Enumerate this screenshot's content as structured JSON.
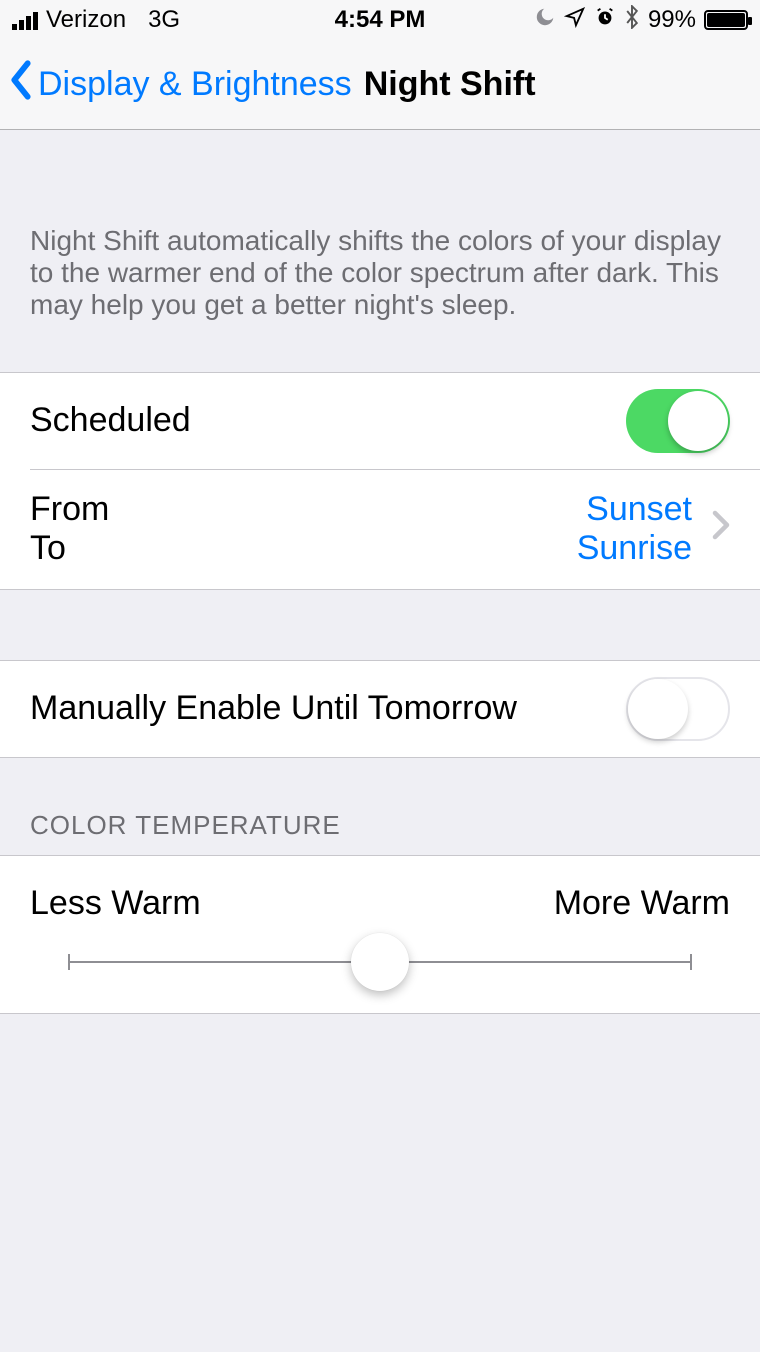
{
  "status": {
    "carrier": "Verizon",
    "network": "3G",
    "time": "4:54 PM",
    "battery_pct": "99%"
  },
  "nav": {
    "back_label": "Display & Brightness",
    "title": "Night Shift"
  },
  "intro": "Night Shift automatically shifts the colors of your display to the warmer end of the color spectrum after dark. This may help you get a better night's sleep.",
  "scheduled": {
    "label": "Scheduled",
    "on": true
  },
  "schedule_range": {
    "from_label": "From",
    "to_label": "To",
    "from_value": "Sunset",
    "to_value": "Sunrise"
  },
  "manual": {
    "label": "Manually Enable Until Tomorrow",
    "on": false
  },
  "color_temp": {
    "header": "COLOR TEMPERATURE",
    "min_label": "Less Warm",
    "max_label": "More Warm",
    "value_pct": 50
  }
}
